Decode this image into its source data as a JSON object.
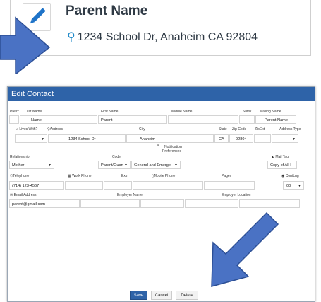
{
  "header_card": {
    "name": "Parent Name",
    "address": "1234 School Dr, Anaheim CA 92804"
  },
  "dialog": {
    "title": "Edit Contact",
    "row1": {
      "prefix_label": "Prefix",
      "last_name_label": "Last Name",
      "first_name_label": "First Name",
      "middle_name_label": "Middle Name",
      "suffix_label": "Suffix",
      "mailing_name_label": "Mailing Name",
      "prefix_value": "",
      "last_name_value": "Name",
      "first_name_value": "Parent",
      "middle_name_value": "",
      "suffix_value": "",
      "mailing_name_value": "Parent Name"
    },
    "row2": {
      "lives_with_label": "Lives With?",
      "address_label": "Address",
      "city_label": "City",
      "state_label": "State",
      "zip_label": "Zip Code",
      "zipext_label": "ZipExt",
      "address_type_label": "Address Type",
      "address_value": "1234 School Dr",
      "city_value": "Anaheim",
      "state_value": "CA",
      "zip_value": "92804",
      "zipext_value": "",
      "address_type_value": ""
    },
    "row3": {
      "notification_label": "Notification",
      "preferences_label": "Preferences",
      "relationship_label": "Relationship",
      "code_label": "Code",
      "mail_tag_label": "Mail Tag",
      "relationship_value": "Mother",
      "code_value": "Parent/Guan",
      "preferences_value": "General and Emerge",
      "mail_tag_value": "Copy of All I"
    },
    "row4": {
      "telephone_label": "Telephone",
      "work_phone_label": "Work Phone",
      "extn_label": "Extn",
      "mobile_phone_label": "Mobile Phone",
      "pager_label": "Pager",
      "contlng_label": "ContLng",
      "telephone_value": "(714) 123-4567",
      "contlng_value": "00"
    },
    "row5": {
      "email_label": "Email Address",
      "employer_name_label": "Employer Name",
      "employer_location_label": "Employer Location",
      "email_value": "parent@gmail.com"
    },
    "buttons": {
      "save": "Save",
      "cancel": "Cancel",
      "delete": "Delete"
    }
  },
  "colors": {
    "header_blue": "#2e63a8",
    "arrow_blue": "#4a72c4",
    "pin_blue": "#1e88c8"
  }
}
